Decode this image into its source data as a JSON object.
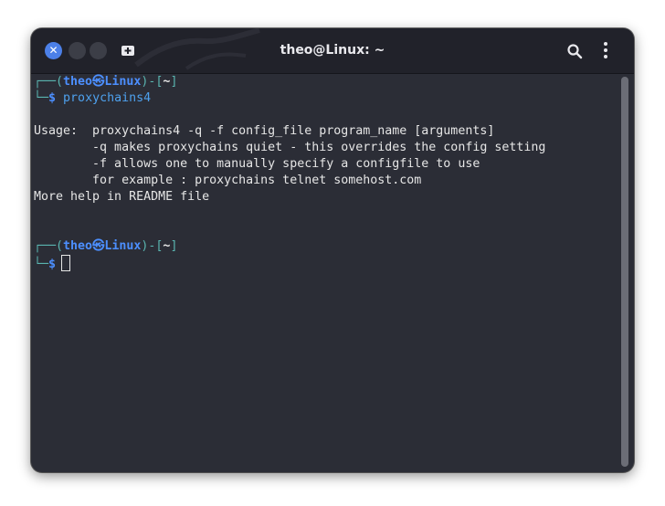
{
  "window": {
    "title": "theo@Linux: ~"
  },
  "titlebar": {
    "close_glyph": "✕",
    "icons": [
      "close-icon",
      "minimize-icon",
      "maximize-icon",
      "new-tab-icon",
      "search-icon",
      "kebab-menu-icon"
    ]
  },
  "prompt": {
    "top_prefix": "┌──(",
    "user": "theo",
    "at_symbol": "㉿",
    "host": "Linux",
    "mid": ")-[",
    "path": "~",
    "close": "]",
    "bottom_prefix": "└─",
    "dollar": "$"
  },
  "session": {
    "command": "proxychains4",
    "output": [
      "Usage:  proxychains4 -q -f config_file program_name [arguments]",
      "        -q makes proxychains quiet - this overrides the config setting",
      "        -f allows one to manually specify a configfile to use",
      "        for example : proxychains telnet somehost.com",
      "More help in README file"
    ]
  },
  "colors": {
    "accent_blue": "#4c8fff",
    "prompt_teal": "#5ab5b0",
    "terminal_bg": "#2b2d36",
    "titlebar_bg": "#21222a"
  }
}
